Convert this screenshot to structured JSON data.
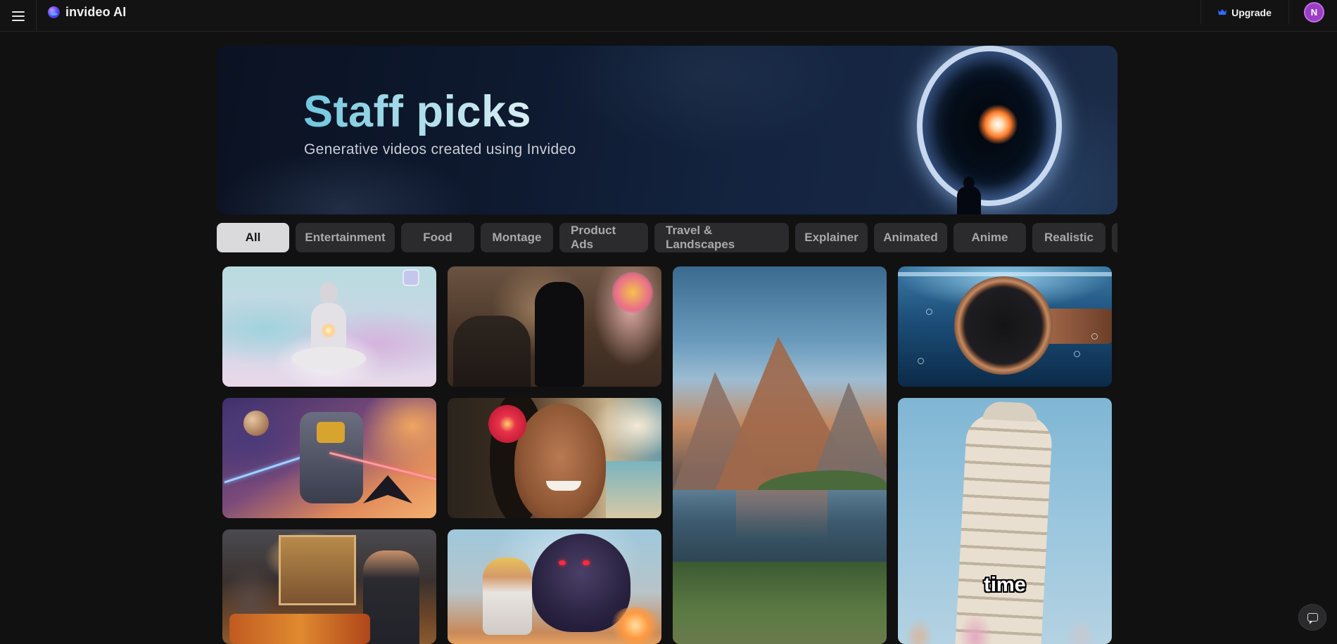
{
  "app": {
    "name": "invideo AI",
    "upgrade_label": "Upgrade",
    "avatar_initial": "N",
    "accent_color": "#2f6bff",
    "avatar_color": "#9a3fc4"
  },
  "hero": {
    "title": "Staff picks",
    "subtitle": "Generative videos created using Invideo"
  },
  "categories": [
    {
      "label": "All",
      "active": true
    },
    {
      "label": "Entertainment",
      "active": false
    },
    {
      "label": "Food",
      "active": false
    },
    {
      "label": "Montage",
      "active": false
    },
    {
      "label": "Product Ads",
      "active": false
    },
    {
      "label": "Travel & Landscapes",
      "active": false
    },
    {
      "label": "Explainer",
      "active": false
    },
    {
      "label": "Animated",
      "active": false
    },
    {
      "label": "Anime",
      "active": false
    },
    {
      "label": "Realistic",
      "active": false
    }
  ],
  "videos": {
    "tower_caption": "time"
  },
  "icons": {
    "menu": "hamburger-icon",
    "logo": "invideo-logo-icon",
    "upgrade": "crown-icon",
    "chat": "chat-icon"
  }
}
